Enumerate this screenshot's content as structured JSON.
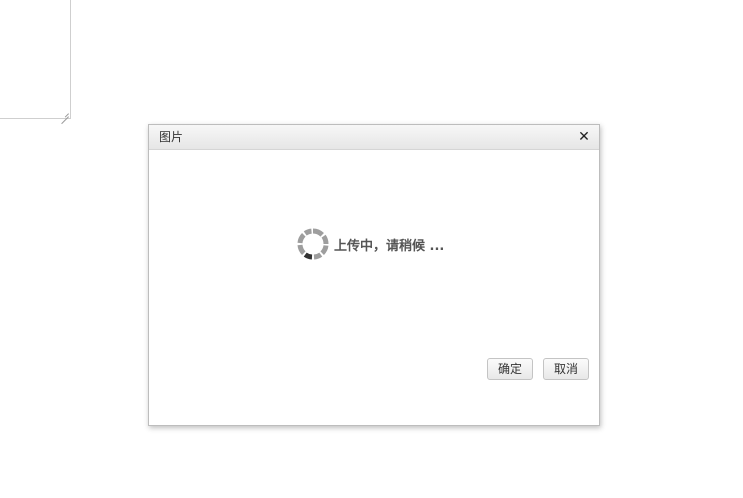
{
  "dialog": {
    "title": "图片",
    "close_glyph": "✕",
    "loading_text": "上传中，请稍候 ...",
    "buttons": {
      "confirm_label": "确定",
      "cancel_label": "取消"
    }
  },
  "icons": {
    "close": "close-icon",
    "spinner": "loading-spinner-icon"
  },
  "colors": {
    "spinner_active": "#333333",
    "spinner_inactive": "#9e9e9e",
    "header_bg": "#ebebeb"
  }
}
